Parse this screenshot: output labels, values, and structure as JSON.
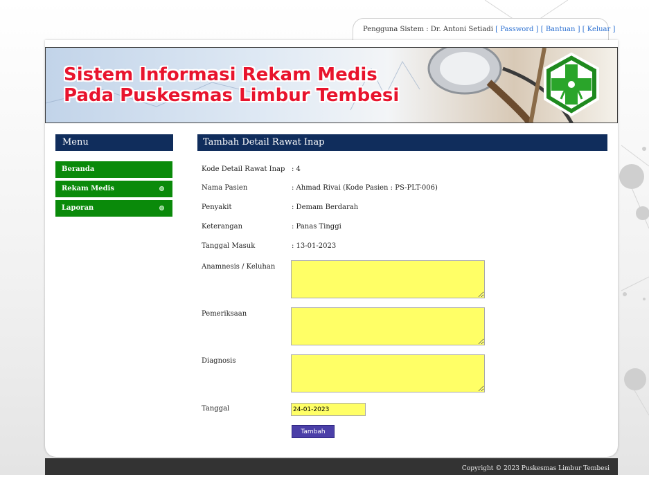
{
  "user_bar": {
    "prefix": "Pengguna Sistem : Dr. Antoni Setiadi",
    "password_link": "[ Password ]",
    "help_link": "[ Bantuan ]",
    "logout_link": "[ Keluar ]"
  },
  "banner": {
    "title_line1": "Sistem Informasi Rekam Medis",
    "title_line2": "Pada Puskesmas Limbur Tembesi"
  },
  "menu": {
    "title": "Menu",
    "items": [
      {
        "label": "Beranda",
        "has_submenu": false
      },
      {
        "label": "Rekam Medis",
        "has_submenu": true
      },
      {
        "label": "Laporan",
        "has_submenu": true
      }
    ]
  },
  "content": {
    "title": "Tambah Detail Rawat Inap",
    "fields": [
      {
        "label": "Kode Detail Rawat Inap",
        "value": ": 4"
      },
      {
        "label": "Nama Pasien",
        "value": ": Ahmad Rivai (Kode Pasien : PS-PLT-006)"
      },
      {
        "label": "Penyakit",
        "value": ": Demam Berdarah"
      },
      {
        "label": "Keterangan",
        "value": ": Panas Tinggi"
      },
      {
        "label": "Tanggal Masuk",
        "value": ": 13-01-2023"
      }
    ],
    "anamnesis_label": "Anamnesis / Keluhan",
    "pemeriksaan_label": "Pemeriksaan",
    "diagnosis_label": "Diagnosis",
    "tanggal_label": "Tanggal",
    "tanggal_value": "24-01-2023",
    "submit_label": "Tambah"
  },
  "footer": {
    "text": "Copyright © 2023 Puskesmas Limbur Tembesi"
  },
  "colors": {
    "header_navy": "#102d5c",
    "menu_green": "#0a8a0a",
    "title_red": "#e8142d",
    "input_yellow": "#ffff66",
    "button_purple": "#4b3fa8",
    "logo_green": "#2aa52a"
  },
  "icons": {
    "logo": "health-cross-logo-icon",
    "submenu_arrow": "submenu-bullet-icon"
  }
}
